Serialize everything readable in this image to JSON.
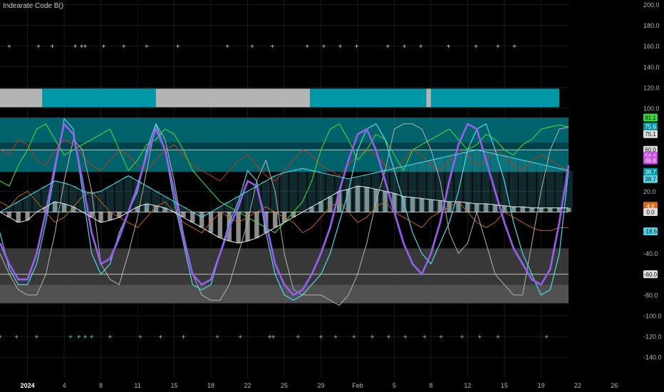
{
  "indicator": {
    "title": "Indearate Code B()"
  },
  "colors": {
    "background": "#000000",
    "grid": "#1a1a1a",
    "axis_text": "#b4b4b4",
    "band_gray": "#b4b4b4",
    "band_teal": "#0097a7",
    "teal_zone": "#007b87",
    "purple": "#d04bf0",
    "blue": "#3a7bd5",
    "green": "#3cd63c",
    "red": "#c0391e",
    "orange": "#d96a1b",
    "white": "#dedede",
    "cyan": "#4fd8e8",
    "gray_zone": "#4a4a4a"
  },
  "chart_data": {
    "type": "line",
    "ylim": [
      -125,
      205
    ],
    "yticks": [
      "200.0",
      "180.0",
      "160.0",
      "140.0",
      "120.0",
      "100.0",
      "20.0",
      "-40.0",
      "-80.0",
      "-100.0",
      "-120.0",
      "-140.0"
    ],
    "ytick_values": [
      200,
      180,
      160,
      140,
      120,
      100,
      20,
      -40,
      -80,
      -100,
      -120,
      -140
    ],
    "x_range": [
      0,
      62
    ],
    "xticks": [
      {
        "x": 3,
        "label": "2024"
      },
      {
        "x": 7,
        "label": "4"
      },
      {
        "x": 11,
        "label": "8"
      },
      {
        "x": 15,
        "label": "11"
      },
      {
        "x": 19,
        "label": "15"
      },
      {
        "x": 23,
        "label": "18"
      },
      {
        "x": 27,
        "label": "22"
      },
      {
        "x": 31,
        "label": "25"
      },
      {
        "x": 35,
        "label": "29"
      },
      {
        "x": 39,
        "label": "Feb"
      },
      {
        "x": 43,
        "label": "5"
      },
      {
        "x": 47,
        "label": "8"
      },
      {
        "x": 51,
        "label": "12"
      },
      {
        "x": 55,
        "label": "15"
      },
      {
        "x": 59,
        "label": "19"
      },
      {
        "x": 63,
        "label": "22"
      },
      {
        "x": 67,
        "label": "26"
      }
    ],
    "hlines": [
      60,
      0,
      -60
    ],
    "zones": [
      {
        "name": "upper-teal-zone",
        "y0": 38.7,
        "y1": 91.1,
        "color": "#006d77"
      },
      {
        "name": "upper-dark-zone",
        "y0": 60.0,
        "y1": 67.0,
        "color": "#003f46"
      },
      {
        "name": "lower-gray-zone",
        "y0": -70.0,
        "y1": -35.0,
        "color": "#3e3e3e"
      },
      {
        "name": "bottom-gray-zone",
        "y0": -88.0,
        "y1": -70.0,
        "color": "#5a5a5a"
      }
    ],
    "regime_band": {
      "y0": 101,
      "y1": 119,
      "segments": [
        {
          "x0": -1,
          "x1": -0.5,
          "color": "#0097a7"
        },
        {
          "x0": -0.5,
          "x1": 17,
          "color": "#b4b4b4"
        },
        {
          "x0": 4.6,
          "x1": 17,
          "color": "#0097a7"
        },
        {
          "x0": 17,
          "x1": 33.8,
          "color": "#b4b4b4"
        },
        {
          "x0": 33.8,
          "x1": 46.5,
          "color": "#0097a7"
        },
        {
          "x0": 46.5,
          "x1": 47,
          "color": "#b4b4b4"
        },
        {
          "x0": 47,
          "x1": 61,
          "color": "#0097a7"
        }
      ]
    },
    "markers_top": {
      "y": 160,
      "x": [
        -1,
        1,
        4.2,
        5.7,
        8.2,
        8.9,
        9.3,
        11.3,
        13.5,
        16,
        19.4,
        24.8,
        27.5,
        29.7,
        33.5,
        35.3,
        37.1,
        38.9,
        42.3,
        44.1,
        45.9,
        48.9,
        51.9,
        54.3,
        56.1
      ]
    },
    "markers_bottom": {
      "y": -120,
      "x": [
        0,
        1.8,
        4,
        7.7,
        8.6,
        9.3,
        10,
        12,
        15.3,
        17.5,
        20,
        23.7,
        26.2,
        29.4,
        29.8,
        32.5,
        35,
        36.6,
        38.6,
        40.6,
        42.4,
        44.2,
        46.3,
        48.1,
        50.4,
        52.3,
        54.3,
        59.6
      ]
    },
    "series": [
      {
        "name": "",
        "color": "#b4b4b4",
        "width": 1,
        "values": [
          -40,
          -60,
          -75,
          -80,
          -80,
          -60,
          -20,
          30,
          70,
          60,
          20,
          -50,
          -65,
          -70,
          -40,
          -5,
          40,
          85,
          70,
          30,
          -20,
          -60,
          -80,
          -85,
          -85,
          -70,
          -40,
          -10,
          30,
          50,
          20,
          -40,
          -75,
          -80,
          -80,
          -80,
          -85,
          -90,
          -80,
          -60,
          -30,
          10,
          40,
          80,
          85,
          85,
          80,
          60,
          30,
          -20,
          -40,
          -30,
          0,
          -30,
          -60,
          -70,
          -80,
          -80,
          -30,
          20,
          60,
          80,
          82
        ]
      },
      {
        "name": "",
        "color": "#4fd8e8",
        "width": 1.2,
        "values": [
          -20,
          -55,
          -70,
          -70,
          -50,
          -10,
          40,
          90,
          80,
          20,
          -40,
          -60,
          -50,
          -20,
          0,
          20,
          60,
          85,
          60,
          10,
          -30,
          -70,
          -75,
          -70,
          -40,
          -10,
          10,
          40,
          30,
          -20,
          -60,
          -80,
          -85,
          -80,
          -70,
          -60,
          -40,
          -10,
          20,
          60,
          80,
          85,
          70,
          40,
          10,
          -20,
          -40,
          -50,
          -30,
          -10,
          20,
          60,
          80,
          85,
          60,
          30,
          -10,
          -40,
          -60,
          -80,
          -75,
          -40,
          40
        ]
      },
      {
        "name": "",
        "color": "#3a7bd5",
        "width": 3.2,
        "values": [
          -30,
          -50,
          -65,
          -65,
          -40,
          0,
          45,
          85,
          75,
          30,
          -20,
          -50,
          -45,
          -25,
          0,
          25,
          55,
          80,
          60,
          20,
          -25,
          -60,
          -70,
          -65,
          -40,
          -15,
          5,
          30,
          25,
          -10,
          -50,
          -70,
          -80,
          -75,
          -60,
          -40,
          -15,
          20,
          50,
          75,
          80,
          60,
          30,
          0,
          -30,
          -50,
          -60,
          -40,
          -10,
          30,
          65,
          85,
          80,
          50,
          20,
          -10,
          -35,
          -50,
          -65,
          -70,
          -55,
          -10,
          45
        ]
      },
      {
        "name": "",
        "color": "#d04bf0",
        "width": 1.6,
        "values": [
          -30,
          -50,
          -65,
          -65,
          -40,
          0,
          45,
          85,
          75,
          30,
          -20,
          -50,
          -45,
          -25,
          0,
          25,
          55,
          80,
          60,
          20,
          -25,
          -60,
          -70,
          -65,
          -40,
          -15,
          5,
          30,
          25,
          -10,
          -50,
          -70,
          -80,
          -75,
          -60,
          -40,
          -15,
          20,
          50,
          75,
          80,
          60,
          30,
          0,
          -30,
          -50,
          -60,
          -40,
          -10,
          30,
          65,
          85,
          80,
          50,
          20,
          -10,
          -35,
          -50,
          -65,
          -70,
          -55,
          -10,
          45
        ]
      },
      {
        "name": "",
        "color": "#3cd63c",
        "width": 1.1,
        "values": [
          30,
          25,
          45,
          60,
          80,
          85,
          70,
          55,
          60,
          65,
          70,
          75,
          80,
          60,
          40,
          50,
          65,
          70,
          80,
          75,
          60,
          40,
          30,
          20,
          10,
          5,
          0,
          -5,
          -10,
          -15,
          -20,
          -10,
          0,
          10,
          30,
          60,
          80,
          85,
          70,
          50,
          60,
          75,
          70,
          55,
          40,
          60,
          65,
          70,
          75,
          80,
          70,
          60,
          65,
          75,
          70,
          60,
          55,
          65,
          70,
          80,
          82,
          84,
          82
        ]
      },
      {
        "name": "",
        "color": "#c0391e",
        "width": 1,
        "values": [
          60,
          55,
          70,
          65,
          50,
          45,
          60,
          70,
          65,
          55,
          45,
          40,
          50,
          60,
          55,
          45,
          40,
          50,
          60,
          65,
          55,
          45,
          40,
          35,
          30,
          40,
          50,
          55,
          45,
          35,
          30,
          40,
          50,
          60,
          55,
          45,
          40,
          35,
          45,
          55,
          60,
          55,
          45,
          40,
          50,
          60,
          55,
          45,
          40,
          50,
          60,
          55,
          45,
          50,
          60,
          55,
          45,
          40,
          50,
          55,
          50,
          45,
          40
        ]
      },
      {
        "name": "",
        "color": "#d96a1b",
        "width": 0.9,
        "values": [
          10,
          5,
          15,
          20,
          10,
          0,
          -10,
          -5,
          5,
          15,
          20,
          10,
          0,
          -5,
          -10,
          -15,
          -5,
          5,
          10,
          0,
          -10,
          -15,
          -20,
          -10,
          0,
          -5,
          -10,
          -5,
          0,
          5,
          0,
          -5,
          -10,
          -20,
          -15,
          -5,
          5,
          10,
          0,
          -10,
          -5,
          5,
          10,
          0,
          -5,
          -10,
          -15,
          -5,
          0,
          5,
          10,
          0,
          -10,
          -15,
          -10,
          0,
          -5,
          -10,
          -15,
          -18,
          -18,
          -15,
          -15
        ]
      },
      {
        "name": "",
        "color": "#dedede",
        "width": 1.1,
        "values": [
          0,
          -5,
          -10,
          -8,
          0,
          5,
          10,
          8,
          5,
          0,
          -5,
          -10,
          -8,
          -5,
          0,
          5,
          8,
          6,
          4,
          0,
          -5,
          -10,
          -15,
          -20,
          -25,
          -28,
          -30,
          -28,
          -25,
          -20,
          -15,
          -10,
          -5,
          0,
          5,
          10,
          15,
          20,
          22,
          25,
          24,
          22,
          20,
          18,
          15,
          14,
          13,
          12,
          11,
          10,
          10,
          9,
          8,
          8,
          7,
          6,
          5,
          5,
          4,
          4,
          4,
          4,
          4
        ]
      },
      {
        "name": "",
        "color": "#4fd8e8",
        "width": 1.1,
        "values": [
          0,
          5,
          10,
          15,
          20,
          25,
          30,
          28,
          25,
          20,
          18,
          20,
          25,
          30,
          35,
          30,
          25,
          20,
          15,
          10,
          5,
          0,
          -5,
          0,
          5,
          10,
          15,
          20,
          25,
          30,
          35,
          38,
          40,
          42,
          40,
          38,
          36,
          34,
          32,
          34,
          36,
          38,
          40,
          42,
          44,
          46,
          48,
          50,
          52,
          54,
          56,
          58,
          60,
          58,
          56,
          54,
          52,
          50,
          48,
          46,
          44,
          42,
          40
        ]
      }
    ],
    "labels_right": [
      {
        "value": "91.1",
        "y": 91.1,
        "color": "#3cd63c"
      },
      {
        "value": "75.6",
        "y": 82.5,
        "color": "#0097a7"
      },
      {
        "value": "75.1",
        "y": 75.1,
        "color": "#dedede"
      },
      {
        "value": "60.0",
        "y": 60.0,
        "color": "#dedede"
      },
      {
        "value": "54.4",
        "y": 54.4,
        "color": "#d04bf0"
      },
      {
        "value": "49.8",
        "y": 49.8,
        "color": "#d04bf0"
      },
      {
        "value": "38.7",
        "y": 38.7,
        "color": "#0097a7"
      },
      {
        "value": "38.7",
        "y": 31.8,
        "color": "#4fd8e8"
      },
      {
        "value": "4.6",
        "y": 6.0,
        "color": "#d96a1b"
      },
      {
        "value": "0.0",
        "y": 0.0,
        "color": "#dedede"
      },
      {
        "value": "-18.6",
        "y": -18.6,
        "color": "#4fd8e8"
      },
      {
        "value": "-60.0",
        "y": -60.0,
        "color": "#dedede"
      }
    ]
  }
}
